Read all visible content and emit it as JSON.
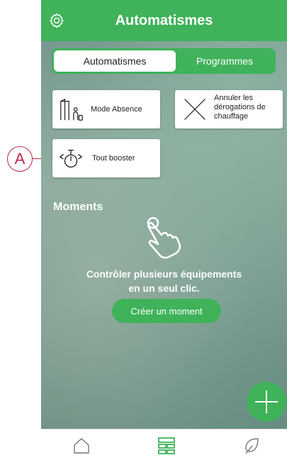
{
  "header": {
    "title": "Automatismes",
    "settings_icon": "gear-icon"
  },
  "segment": {
    "tabs": [
      {
        "label": "Automatismes",
        "active": true
      },
      {
        "label": "Programmes",
        "active": false
      }
    ]
  },
  "tiles": [
    {
      "label": "Mode Absence",
      "icon": "away-person-icon"
    },
    {
      "label": "Annuler les dérogations de chauffage",
      "label_lines": [
        "Annuler les",
        "dérogations de",
        "chauffage"
      ],
      "icon": "cross-icon"
    },
    {
      "label": "Tout booster",
      "icon": "boost-timer-icon"
    }
  ],
  "moments": {
    "title": "Moments",
    "icon": "hand-tap-icon",
    "description_lines": [
      "Contrôler plusieurs équipements",
      "en un seul clic."
    ],
    "create_button": "Créer un moment"
  },
  "fab": {
    "icon": "plus-icon"
  },
  "bottom_nav": [
    {
      "icon": "home-icon"
    },
    {
      "icon": "grid-icon",
      "active": true
    },
    {
      "icon": "leaf-icon"
    }
  ],
  "annotation": {
    "label": "A"
  },
  "colors": {
    "accent": "#3fb25a",
    "callout": "#c3264a"
  }
}
